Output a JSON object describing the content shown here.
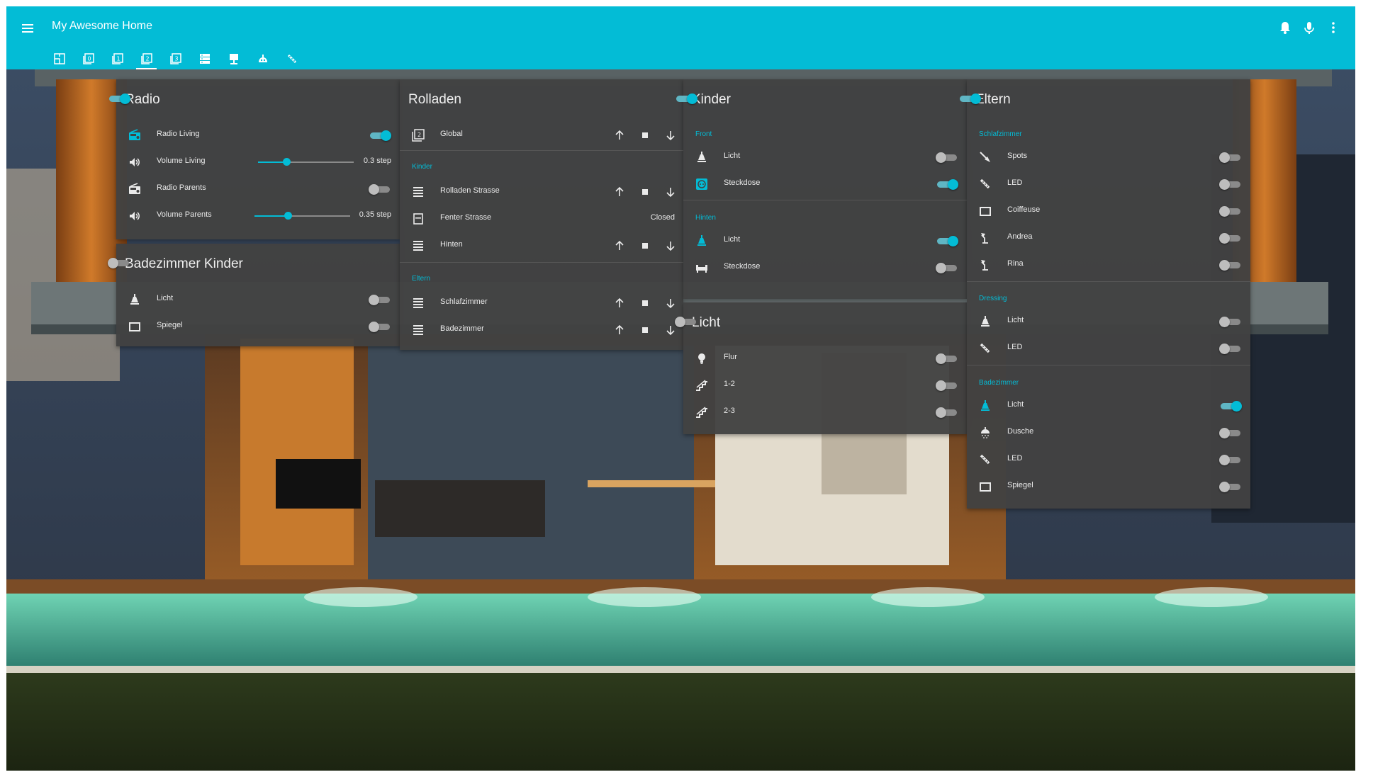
{
  "header": {
    "title": "My Awesome Home",
    "menu_icon": "hamburger-menu-icon",
    "right_icons": [
      "bell-icon",
      "microphone-icon",
      "more-vertical-icon"
    ],
    "tabs": [
      {
        "icon": "floorplan-icon",
        "active": false
      },
      {
        "icon": "floor-0-icon",
        "active": false
      },
      {
        "icon": "floor-1-icon",
        "active": false
      },
      {
        "icon": "floor-2-icon",
        "active": true
      },
      {
        "icon": "floor-3-icon",
        "active": false
      },
      {
        "icon": "server-icon",
        "active": false
      },
      {
        "icon": "desk-lamp-icon",
        "active": false
      },
      {
        "icon": "robot-icon",
        "active": false
      },
      {
        "icon": "led-strip-icon",
        "active": false
      }
    ]
  },
  "colors": {
    "accent": "#03bcd6",
    "card_bg": "#424242",
    "text": "#eaeaea"
  },
  "cards": {
    "radio": {
      "title": "Radio",
      "on": true,
      "rows": [
        {
          "label": "Radio Living",
          "icon": "radio-icon",
          "toggle": true
        },
        {
          "label": "Volume Living",
          "icon": "volume-icon",
          "value": "0.3 step",
          "slider": 0.3
        },
        {
          "label": "Radio Parents",
          "icon": "radio-icon",
          "toggle": false
        },
        {
          "label": "Volume Parents",
          "icon": "volume-icon",
          "value": "0.35 step",
          "slider": 0.35
        }
      ]
    },
    "bad_kinder": {
      "title": "Badezimmer Kinder",
      "on": false,
      "rows": [
        {
          "label": "Licht",
          "icon": "ceiling-light-icon",
          "toggle": false
        },
        {
          "label": "Spiegel",
          "icon": "mirror-icon",
          "toggle": false
        }
      ]
    },
    "rolladen": {
      "title": "Rolladen",
      "rows": [
        {
          "label": "Global",
          "icon": "group-icon"
        },
        {
          "label": "Rolladen Strasse",
          "icon": "shutter-icon"
        },
        {
          "label": "Fenter Strasse",
          "icon": "window-shutter-icon",
          "value": "Closed"
        },
        {
          "label": "Hinten",
          "icon": "shutter-icon"
        },
        {
          "label": "Schlafzimmer",
          "icon": "shutter-icon"
        },
        {
          "label": "Badezimmer",
          "icon": "shutter-icon"
        }
      ],
      "sections": [
        "Kinder",
        "Eltern"
      ]
    },
    "kinder": {
      "title": "Kinder",
      "on": true,
      "sections": [
        "Front",
        "Hinten"
      ],
      "rows": [
        {
          "label": "Licht",
          "icon": "ceiling-light-icon",
          "toggle": false
        },
        {
          "label": "Steckdose",
          "icon": "power-socket-icon",
          "toggle": true
        },
        {
          "label": "Licht",
          "icon": "ceiling-light-icon",
          "toggle": true
        },
        {
          "label": "Steckdose",
          "icon": "sofa-icon",
          "toggle": false
        }
      ]
    },
    "licht": {
      "title": "Licht",
      "on": false,
      "rows": [
        {
          "label": "Flur",
          "icon": "lightbulb-icon",
          "toggle": false
        },
        {
          "label": "1-2",
          "icon": "stairs-icon",
          "toggle": false
        },
        {
          "label": "2-3",
          "icon": "stairs-icon",
          "toggle": false
        }
      ]
    },
    "eltern": {
      "title": "Eltern",
      "on": true,
      "sections": [
        "Schlafzimmer",
        "Dressing",
        "Badezimmer"
      ],
      "rows": [
        {
          "label": "Spots",
          "icon": "spotlight-icon",
          "toggle": false
        },
        {
          "label": "LED",
          "icon": "led-strip-icon",
          "toggle": false
        },
        {
          "label": "Coiffeuse",
          "icon": "mirror-icon",
          "toggle": false
        },
        {
          "label": "Andrea",
          "icon": "desk-lamp-icon",
          "toggle": false
        },
        {
          "label": "Rina",
          "icon": "desk-lamp-icon",
          "toggle": false
        },
        {
          "label": "Licht",
          "icon": "ceiling-light-icon",
          "toggle": false
        },
        {
          "label": "LED",
          "icon": "led-strip-icon",
          "toggle": false
        },
        {
          "label": "Licht",
          "icon": "ceiling-light-icon",
          "toggle": true
        },
        {
          "label": "Dusche",
          "icon": "shower-icon",
          "toggle": false
        },
        {
          "label": "LED",
          "icon": "led-strip-icon",
          "toggle": false
        },
        {
          "label": "Spiegel",
          "icon": "mirror-icon",
          "toggle": false
        }
      ]
    }
  }
}
